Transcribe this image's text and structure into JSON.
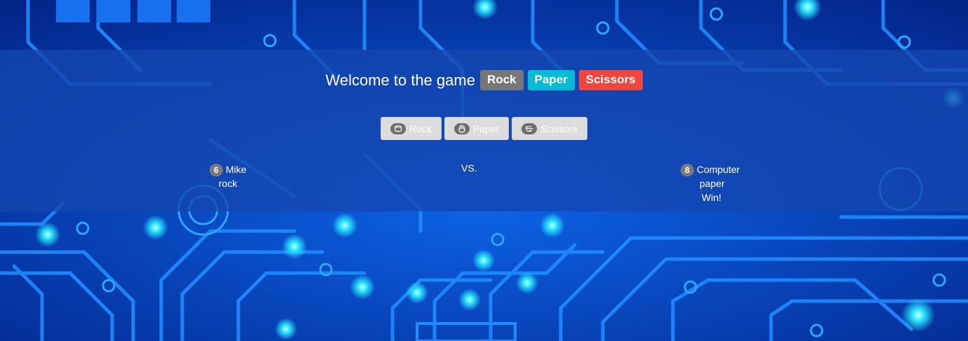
{
  "header": {
    "title": "Welcome to the game",
    "labels": [
      {
        "text": "Rock",
        "color": "#777777"
      },
      {
        "text": "Paper",
        "color": "#00bcd4"
      },
      {
        "text": "Scissors",
        "color": "#f0463c"
      }
    ]
  },
  "choices": [
    {
      "label": "Rock",
      "icon": "fist-icon"
    },
    {
      "label": "Paper",
      "icon": "open-hand-icon"
    },
    {
      "label": "Scissors",
      "icon": "scissors-hand-icon"
    }
  ],
  "player": {
    "score": "6",
    "name": "Mike",
    "choice": "rock"
  },
  "versus": "VS.",
  "computer": {
    "score": "8",
    "name": "Computer",
    "choice": "paper",
    "result": "Win!"
  },
  "theme": {
    "background": "circuit-board",
    "panel": "#1446af"
  }
}
